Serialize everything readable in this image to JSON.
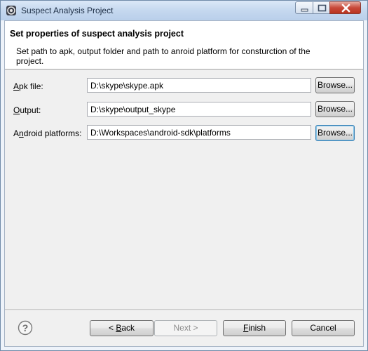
{
  "window": {
    "title": "Suspect Analysis Project",
    "controls": {
      "minimize": "minimize",
      "maximize": "maximize",
      "close": "close"
    }
  },
  "header": {
    "title": "Set properties of suspect analysis project",
    "description": "Set path to apk, output folder and path to anroid platform for consturction of the project."
  },
  "form": {
    "rows": [
      {
        "label_mnemonic": "A",
        "label_rest": "pk file:",
        "value": "D:\\skype\\skype.apk",
        "button": "Browse..."
      },
      {
        "label_mnemonic": "O",
        "label_rest": "utput:",
        "value": "D:\\skype\\output_skype",
        "button": "Browse..."
      },
      {
        "label_prefix": "A",
        "label_mnemonic": "n",
        "label_rest": "droid platforms:",
        "value": "D:\\Workspaces\\android-sdk\\platforms",
        "button": "Browse..."
      }
    ]
  },
  "footer": {
    "help_icon": "help-icon",
    "back": {
      "prefix": "< ",
      "mnemonic": "B",
      "rest": "ack"
    },
    "next": "Next >",
    "finish": {
      "mnemonic": "F",
      "rest": "inish"
    },
    "cancel": "Cancel"
  },
  "colors": {
    "titlebar": "#c5d8ef",
    "client_bg": "#f0f0f0",
    "header_bg": "#ffffff",
    "close_button": "#c8493a"
  }
}
